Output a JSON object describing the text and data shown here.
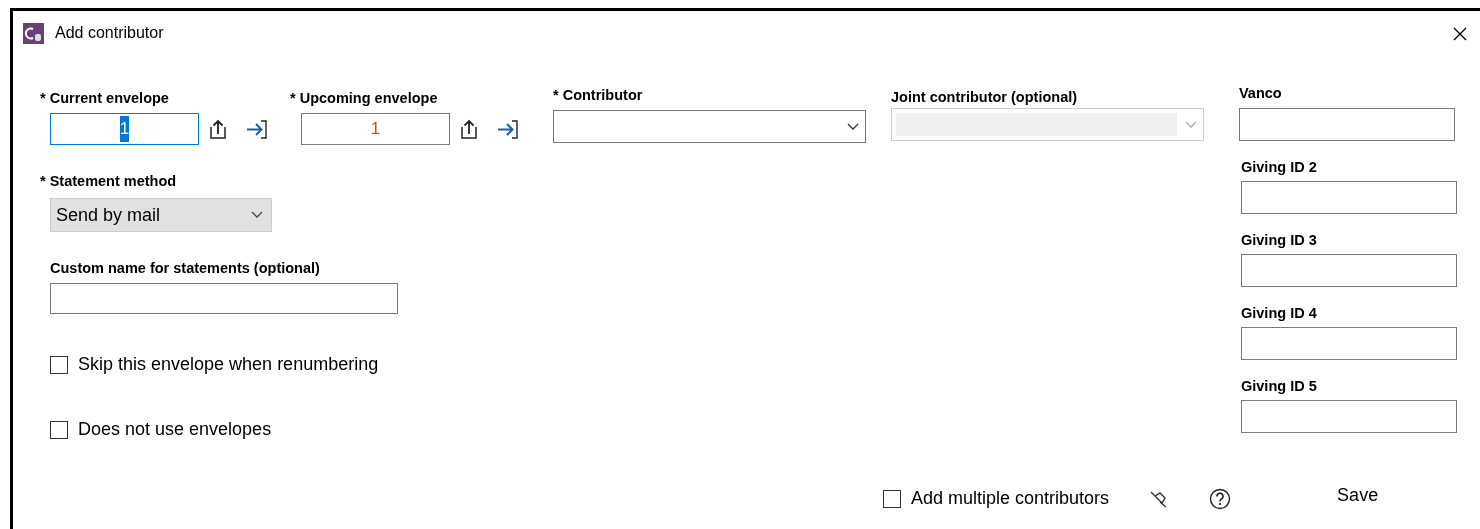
{
  "window": {
    "title": "Add contributor"
  },
  "envelope_fields": [
    {
      "label": "* Current envelope",
      "value": "1",
      "focused": true
    },
    {
      "label": "* Upcoming envelope",
      "value": "1",
      "focused": false
    }
  ],
  "contributor": {
    "label": "* Contributor"
  },
  "joint_contributor": {
    "label": "Joint contributor (optional)",
    "disabled": true
  },
  "statement_method": {
    "label": "* Statement method",
    "value": "Send by mail"
  },
  "custom_name": {
    "label": "Custom name for statements (optional)"
  },
  "options": [
    {
      "label": "Skip this envelope when renumbering",
      "checked": false
    },
    {
      "label": "Does not use envelopes",
      "checked": false
    }
  ],
  "giving_ids": [
    {
      "label": "Vanco"
    },
    {
      "label": "Giving ID 2"
    },
    {
      "label": "Giving ID 3"
    },
    {
      "label": "Giving ID 4"
    },
    {
      "label": "Giving ID 5"
    }
  ],
  "footer": {
    "multiple": {
      "label": "Add multiple contributors",
      "checked": false
    },
    "save": "Save"
  }
}
